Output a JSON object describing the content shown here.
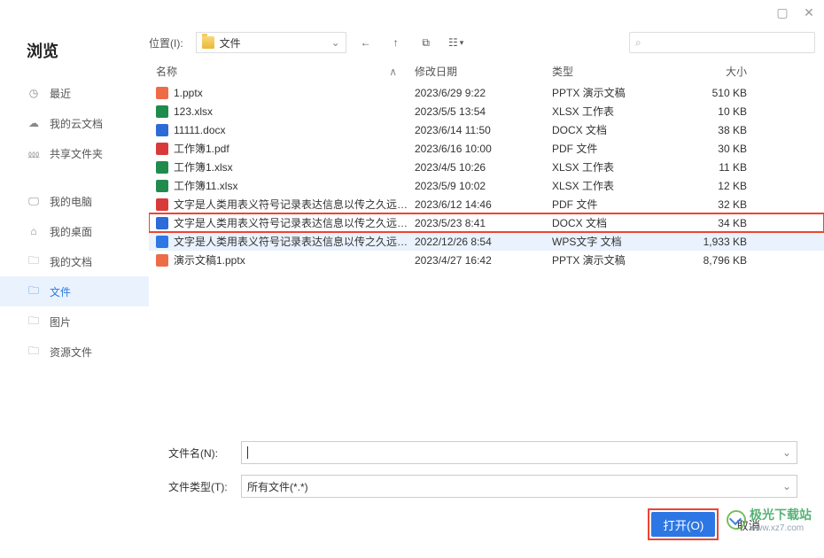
{
  "window": {
    "maximize_icon": "▢",
    "close_icon": "✕"
  },
  "sidebar": {
    "title": "浏览",
    "group1": [
      {
        "icon": "clock",
        "label": "最近"
      },
      {
        "icon": "cloud",
        "label": "我的云文档"
      },
      {
        "icon": "share",
        "label": "共享文件夹"
      }
    ],
    "group2": [
      {
        "icon": "monitor",
        "label": "我的电脑"
      },
      {
        "icon": "desktop",
        "label": "我的桌面"
      },
      {
        "icon": "folder",
        "label": "我的文档"
      },
      {
        "icon": "folder",
        "label": "文件",
        "active": true
      },
      {
        "icon": "folder",
        "label": "图片"
      },
      {
        "icon": "folder",
        "label": "资源文件"
      }
    ]
  },
  "toolbar": {
    "location_label": "位置(I):",
    "location_value": "文件",
    "back_icon": "←",
    "up_icon": "↑",
    "newwin_icon": "⧉",
    "view_icon": "☷",
    "view_chev": "▾",
    "search_icon": "⌕"
  },
  "columns": {
    "name": "名称",
    "date": "修改日期",
    "type": "类型",
    "size": "大小",
    "sort": "∧"
  },
  "files": [
    {
      "icon": "pptx",
      "name": "1.pptx",
      "date": "2023/6/29 9:22",
      "type": "PPTX 演示文稿",
      "size": "510 KB"
    },
    {
      "icon": "xlsx",
      "name": "123.xlsx",
      "date": "2023/5/5 13:54",
      "type": "XLSX 工作表",
      "size": "10 KB"
    },
    {
      "icon": "docx",
      "name": "11111.docx",
      "date": "2023/6/14 11:50",
      "type": "DOCX 文档",
      "size": "38 KB"
    },
    {
      "icon": "pdf",
      "name": "工作簿1.pdf",
      "date": "2023/6/16 10:00",
      "type": "PDF 文件",
      "size": "30 KB"
    },
    {
      "icon": "xlsx",
      "name": "工作簿1.xlsx",
      "date": "2023/4/5 10:26",
      "type": "XLSX 工作表",
      "size": "11 KB"
    },
    {
      "icon": "xlsx",
      "name": "工作簿11.xlsx",
      "date": "2023/5/9 10:02",
      "type": "XLSX 工作表",
      "size": "12 KB"
    },
    {
      "icon": "pdf",
      "name": "文字是人类用表义符号记录表达信息以传之久远的…",
      "date": "2023/6/12 14:46",
      "type": "PDF 文件",
      "size": "32 KB"
    },
    {
      "icon": "docx",
      "name": "文字是人类用表义符号记录表达信息以传之久远的…",
      "date": "2023/5/23 8:41",
      "type": "DOCX 文档",
      "size": "34 KB",
      "highlight": true
    },
    {
      "icon": "wps",
      "name": "文字是人类用表义符号记录表达信息以传之久远的…",
      "date": "2022/12/26 8:54",
      "type": "WPS文字 文档",
      "size": "1,933 KB",
      "selected": true
    },
    {
      "icon": "pptx",
      "name": "演示文稿1.pptx",
      "date": "2023/4/27 16:42",
      "type": "PPTX 演示文稿",
      "size": "8,796 KB"
    }
  ],
  "bottom": {
    "filename_label": "文件名(N):",
    "filename_value": "",
    "filetype_label": "文件类型(T):",
    "filetype_value": "所有文件(*.*)",
    "open_label": "打开(O)",
    "cancel_label": "取消"
  },
  "watermark": {
    "text": "极光下载站",
    "url": "www.xz7.com"
  },
  "icons": {
    "clock": "◷",
    "cloud": "☁",
    "share": "⅏",
    "monitor": "🖵",
    "desktop": "⌂",
    "folder": "🗀"
  }
}
